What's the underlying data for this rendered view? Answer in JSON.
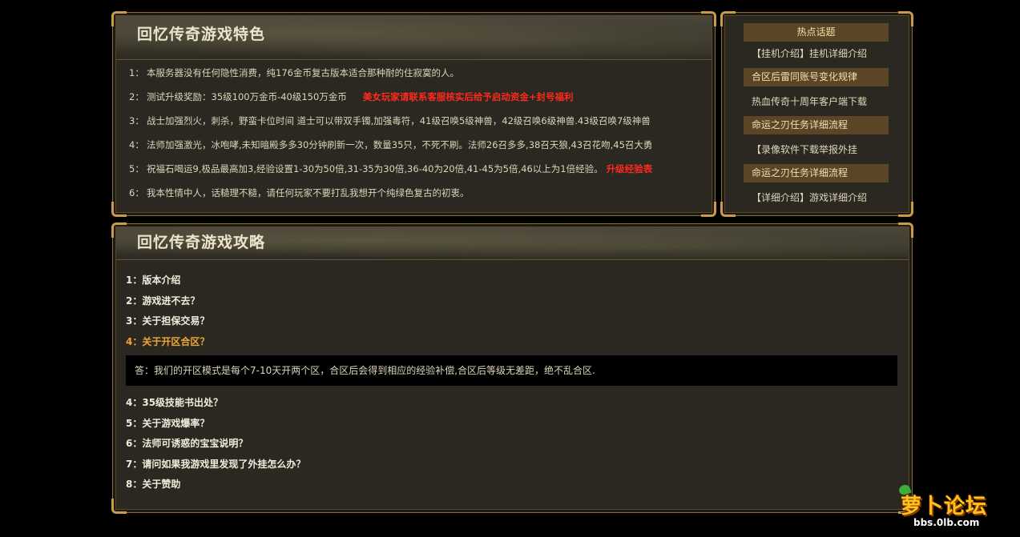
{
  "features": {
    "title": "回忆传奇游戏特色",
    "items": [
      {
        "num": "1：",
        "text": "本服务器没有任何隐性消费，纯176金币复古版本适合那种耐的住寂寞的人。"
      },
      {
        "num": "2：",
        "text": "测试升级奖励：35级100万金币-40级150万金币",
        "highlight": "美女玩家请联系客服核实后给予启动资金+封号福利"
      },
      {
        "num": "3：",
        "text": "战士加强烈火，刺杀，野蛮卡位时间 道士可以带双手镯,加强毒符，41级召唤5级神兽，42级召唤6级神兽.43级召唤7级神兽"
      },
      {
        "num": "4：",
        "text": "法师加强激光，冰咆哮,未知暗殿多多30分钟刷新一次，数量35只，不死不刷。法师26召多多,38召天狼,43召花吻,45召大勇"
      },
      {
        "num": "5：",
        "text": "祝福石喝运9,极品最高加3,经验设置1-30为50倍,31-35为30倍,36-40为20倍,41-45为5倍,46以上为1倍经验。",
        "highlight": "升级经验表"
      },
      {
        "num": "6：",
        "text": "我本性情中人，话糙理不糙，请任何玩家不要打乱我想开个纯绿色复古的初衷。"
      }
    ]
  },
  "hot": {
    "title": "热点话题",
    "items": [
      {
        "text": "【挂机介绍】挂机详细介绍",
        "highlight": false
      },
      {
        "text": "合区后雷同账号变化规律",
        "highlight": true
      },
      {
        "text": "热血传奇十周年客户端下载",
        "highlight": false
      },
      {
        "text": "命运之刃任务详细流程",
        "highlight": true
      },
      {
        "text": "【录像软件下载举报外挂",
        "highlight": false
      },
      {
        "text": "命运之刃任务详细流程",
        "highlight": true
      },
      {
        "text": "【详细介绍】游戏详细介绍",
        "highlight": false
      }
    ]
  },
  "guide": {
    "title": "回忆传奇游戏攻略",
    "questions_before": [
      "1：版本介绍",
      "2：游戏进不去？",
      "3：关于担保交易？"
    ],
    "active_question": "4：关于开区合区？",
    "answer": "答：我们的开区模式是每个7-10天开两个区，合区后会得到相应的经验补偿,合区后等级无差距，绝不乱合区.",
    "questions_after": [
      "4：35级技能书出处？",
      "5：关于游戏爆率？",
      "6：法师可诱惑的宝宝说明？",
      "7：请问如果我游戏里发现了外挂怎么办？",
      "8：关于赞助"
    ]
  },
  "watermark": {
    "logo_text": "萝卜论坛",
    "url": "bbs.0lb.com"
  }
}
